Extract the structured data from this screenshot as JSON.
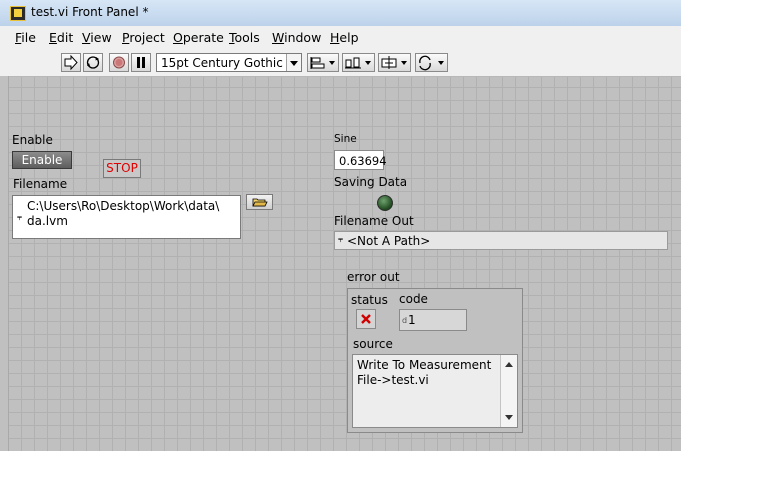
{
  "window": {
    "title": "test.vi Front Panel *"
  },
  "menu": {
    "items": [
      {
        "label": "File",
        "key": "F",
        "rest": "ile"
      },
      {
        "label": "Edit",
        "key": "E",
        "rest": "dit"
      },
      {
        "label": "View",
        "key": "V",
        "rest": "iew"
      },
      {
        "label": "Project",
        "key": "P",
        "rest": "roject"
      },
      {
        "label": "Operate",
        "key": "O",
        "rest": "perate"
      },
      {
        "label": "Tools",
        "key": "T",
        "rest": "ools"
      },
      {
        "label": "Window",
        "key": "W",
        "rest": "indow"
      },
      {
        "label": "Help",
        "key": "H",
        "rest": "elp"
      }
    ]
  },
  "toolbar": {
    "font": "15pt Century Gothic"
  },
  "controls": {
    "enable_label": "Enable",
    "enable_button": "Enable",
    "stop_button": "STOP",
    "filename_label": "Filename",
    "filename_value": "C:\\Users\\Ro\\Desktop\\Work\\data\\ da.lvm",
    "sine_label": "Sine",
    "sine_value": "0.63694",
    "saving_label": "Saving Data",
    "filename_out_label": "Filename Out",
    "filename_out_value": "<Not A Path>"
  },
  "error_out": {
    "label": "error out",
    "status_label": "status",
    "code_label": "code",
    "code_value": "1",
    "source_label": "source",
    "source_value": "Write To Measurement File->test.vi"
  },
  "colors": {
    "stop_text": "#e00000",
    "panel_bg": "#c0c0c0",
    "led_off": "#1f4a1f"
  }
}
